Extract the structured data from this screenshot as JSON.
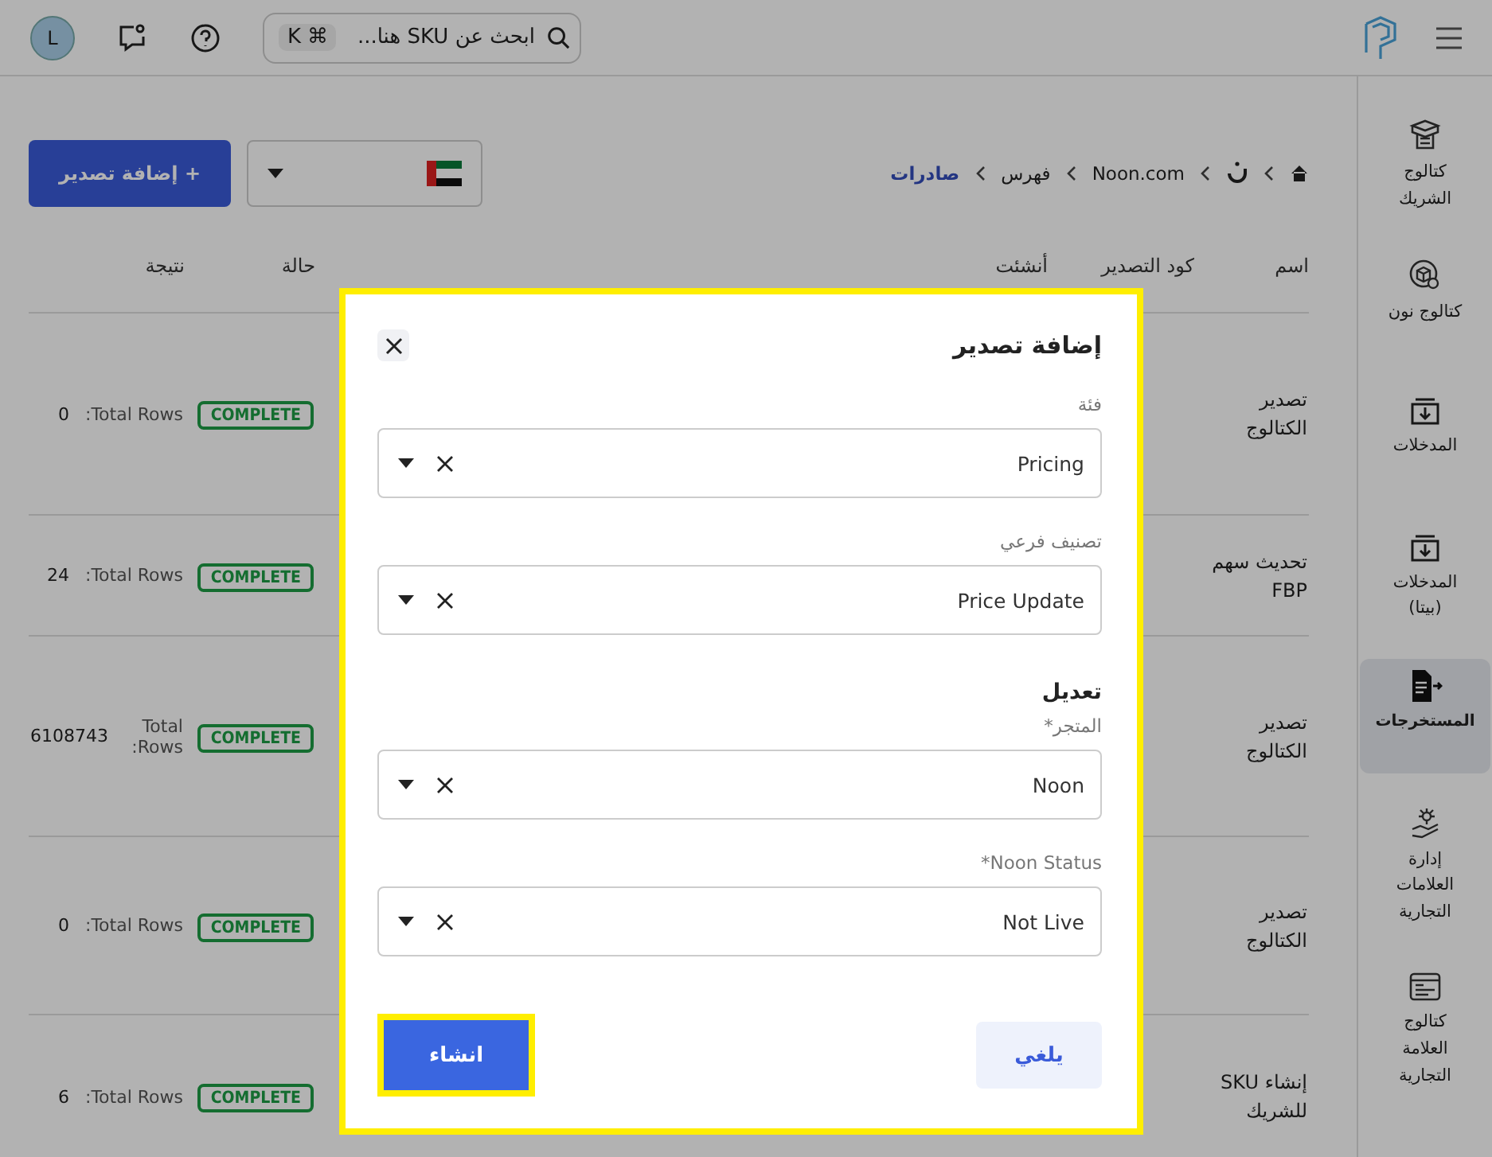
{
  "topbar": {
    "avatar": "L",
    "search": {
      "placeholder": "ابحث عن SKU هنا...",
      "keys": [
        "⌘",
        "K"
      ]
    }
  },
  "sidebar": {
    "items": [
      {
        "label": "كتالوج الشريك",
        "selected": false
      },
      {
        "label": "كتالوج نون",
        "selected": false
      },
      {
        "label": "المدخلات",
        "selected": false
      },
      {
        "label": "المدخلات (بيتا)",
        "selected": false
      },
      {
        "label": "المستخرجات",
        "selected": true
      },
      {
        "label": "إدارة العلامات التجارية",
        "selected": false
      },
      {
        "label": "كتالوج العلامة التجارية",
        "selected": false
      }
    ]
  },
  "breadcrumb": [
    "Noon.com",
    "فهرس",
    "صادرات"
  ],
  "add_button": "+ إضافة تصدير",
  "table": {
    "columns": [
      "اسم",
      "كود التصدير",
      "أنشئت",
      "حالة",
      "نتيجة"
    ],
    "rows": [
      {
        "name": "تصدير الكتالوج",
        "status": "COMPLETE",
        "result_label": "Total Rows:",
        "result": "0"
      },
      {
        "name": "تحديث سهم FBP",
        "status": "COMPLETE",
        "result_label": "Total Rows:",
        "result": "24"
      },
      {
        "name": "تصدير الكتالوج",
        "status": "COMPLETE",
        "result_label": "Total Rows:",
        "result": "6108743"
      },
      {
        "name": "تصدير الكتالوج",
        "status": "COMPLETE",
        "result_label": "Total Rows:",
        "result": "0"
      },
      {
        "name": "إنشاء SKU للشريك",
        "status": "COMPLETE",
        "result_label": "Total Rows:",
        "result": "6"
      }
    ]
  },
  "modal": {
    "title": "إضافة تصدير",
    "fields": [
      {
        "kind": "select",
        "label": "فئة",
        "value": "Pricing"
      },
      {
        "kind": "select",
        "label": "تصنيف فرعي",
        "value": "Price Update"
      },
      {
        "kind": "heading",
        "label": "تعديل"
      },
      {
        "kind": "select",
        "label": "المتجر*",
        "value": "Noon"
      },
      {
        "kind": "select",
        "label": "Noon Status*",
        "value": "Not Live"
      }
    ],
    "cancel": "يلغي",
    "create": "انشاء"
  }
}
